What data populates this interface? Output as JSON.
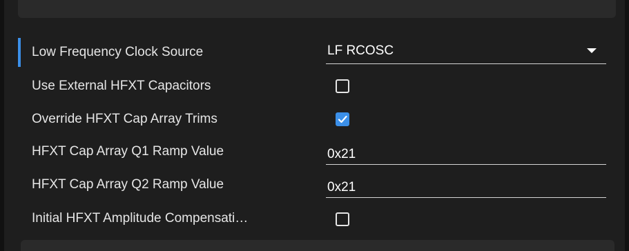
{
  "settings": {
    "rows": [
      {
        "label": "Low Frequency Clock Source",
        "type": "dropdown",
        "value": "LF RCOSC"
      },
      {
        "label": "Use External HFXT Capacitors",
        "type": "checkbox",
        "checked": false
      },
      {
        "label": "Override HFXT Cap Array Trims",
        "type": "checkbox",
        "checked": true
      },
      {
        "label": "HFXT Cap Array Q1 Ramp Value",
        "type": "text",
        "value": "0x21"
      },
      {
        "label": "HFXT Cap Array Q2 Ramp Value",
        "type": "text",
        "value": "0x21"
      },
      {
        "label": "Initial HFXT Amplitude Compensati…",
        "type": "checkbox",
        "checked": false
      }
    ]
  },
  "colors": {
    "accent": "#3b8fe8",
    "background": "#1e1e1e",
    "text": "#e6e6e6"
  },
  "icons": {
    "dropdown": "chevron-down-icon",
    "check": "checkmark-icon"
  }
}
